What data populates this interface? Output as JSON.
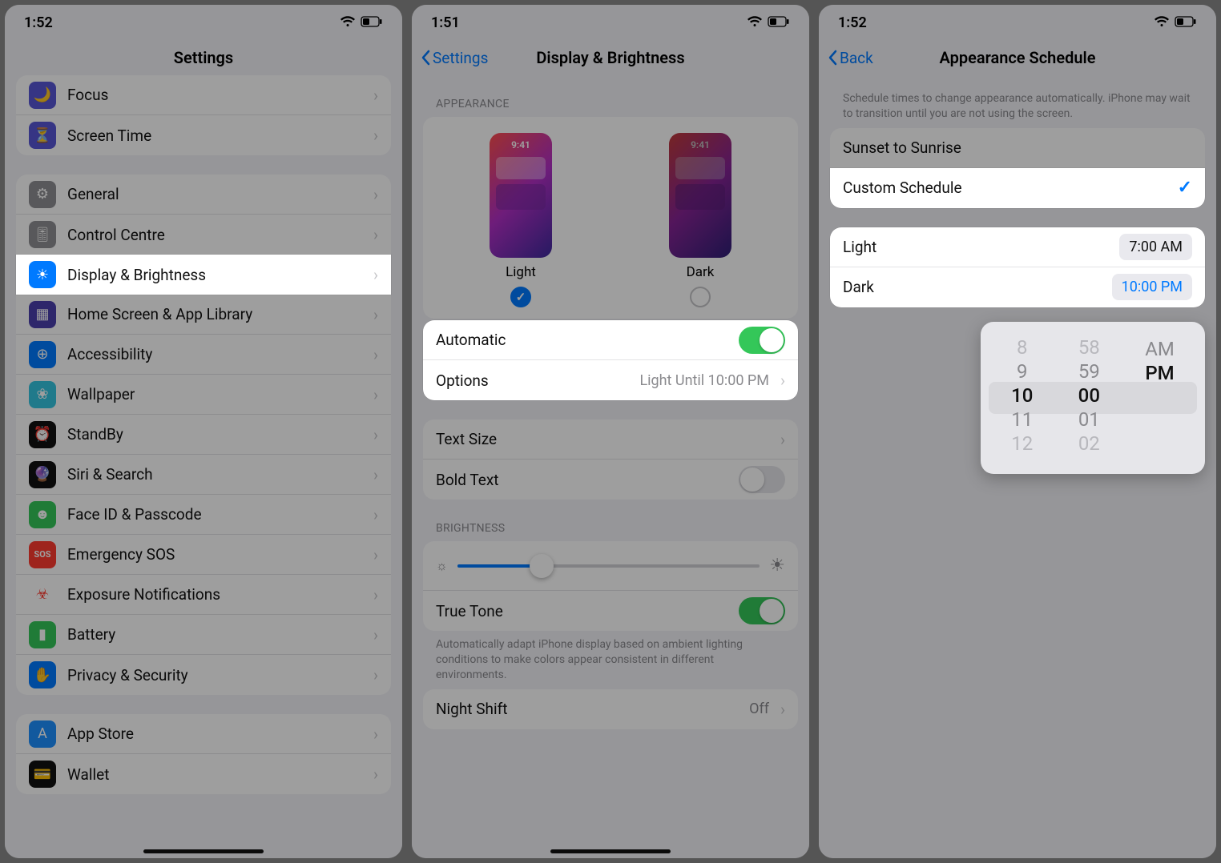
{
  "status_time_1": "1:52",
  "status_time_2": "1:51",
  "status_time_3": "1:52",
  "screen1": {
    "title": "Settings",
    "group1": [
      {
        "icon_bg": "#5856d6",
        "icon": "🌙",
        "label": "Focus"
      },
      {
        "icon_bg": "#5856d6",
        "icon": "⏳",
        "label": "Screen Time"
      }
    ],
    "group2": [
      {
        "icon_bg": "#8e8e93",
        "icon": "⚙︎",
        "label": "General"
      },
      {
        "icon_bg": "#8e8e93",
        "icon": "🎚︎",
        "label": "Control Centre"
      },
      {
        "icon_bg": "#007aff",
        "icon": "☀︎",
        "label": "Display & Brightness",
        "highlight": true
      },
      {
        "icon_bg": "#4b3fad",
        "icon": "▦",
        "label": "Home Screen & App Library"
      },
      {
        "icon_bg": "#007aff",
        "icon": "⊕",
        "label": "Accessibility"
      },
      {
        "icon_bg": "#34c5e0",
        "icon": "❀",
        "label": "Wallpaper"
      },
      {
        "icon_bg": "#111",
        "icon": "⏰",
        "label": "StandBy"
      },
      {
        "icon_bg": "#111",
        "icon": "🔮",
        "label": "Siri & Search"
      },
      {
        "icon_bg": "#34c759",
        "icon": "☻",
        "label": "Face ID & Passcode"
      },
      {
        "icon_bg": "#ff3b30",
        "icon": "SOS",
        "label": "Emergency SOS"
      },
      {
        "icon_bg": "#fff",
        "icon": "☣︎",
        "label": "Exposure Notifications",
        "fg": "#ff3b30"
      },
      {
        "icon_bg": "#34c759",
        "icon": "▮",
        "label": "Battery"
      },
      {
        "icon_bg": "#007aff",
        "icon": "✋",
        "label": "Privacy & Security"
      }
    ],
    "group3": [
      {
        "icon_bg": "#1e90ff",
        "icon": "A",
        "label": "App Store"
      },
      {
        "icon_bg": "#111",
        "icon": "💳",
        "label": "Wallet"
      }
    ]
  },
  "screen2": {
    "back": "Settings",
    "title": "Display & Brightness",
    "section_appearance": "APPEARANCE",
    "mock_time": "9:41",
    "light_label": "Light",
    "dark_label": "Dark",
    "automatic_label": "Automatic",
    "options_label": "Options",
    "options_value": "Light Until 10:00 PM",
    "text_size": "Text Size",
    "bold_text": "Bold Text",
    "section_brightness": "BRIGHTNESS",
    "true_tone": "True Tone",
    "true_tone_footer": "Automatically adapt iPhone display based on ambient lighting conditions to make colors appear consistent in different environments.",
    "night_shift": "Night Shift",
    "night_shift_value": "Off"
  },
  "screen3": {
    "back": "Back",
    "title": "Appearance Schedule",
    "header_text": "Schedule times to change appearance automatically. iPhone may wait to transition until you are not using the screen.",
    "sunset": "Sunset to Sunrise",
    "custom": "Custom Schedule",
    "light_label": "Light",
    "light_time": "7:00 AM",
    "dark_label": "Dark",
    "dark_time": "10:00 PM",
    "picker": {
      "hours": [
        "8",
        "9",
        "10",
        "11",
        "12"
      ],
      "mins": [
        "58",
        "59",
        "00",
        "01",
        "02"
      ],
      "ampm": [
        "AM",
        "PM"
      ]
    }
  }
}
